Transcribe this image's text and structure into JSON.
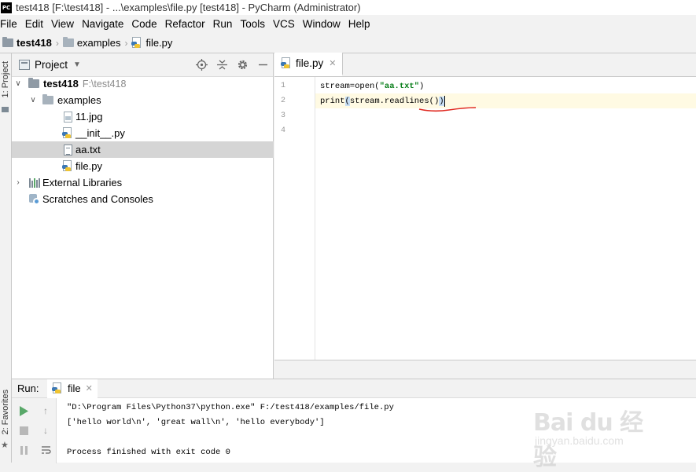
{
  "window": {
    "title": "test418 [F:\\test418] - ...\\examples\\file.py [test418] - PyCharm (Administrator)"
  },
  "menu": [
    "File",
    "Edit",
    "View",
    "Navigate",
    "Code",
    "Refactor",
    "Run",
    "Tools",
    "VCS",
    "Window",
    "Help"
  ],
  "breadcrumb": {
    "project": "test418",
    "folder": "examples",
    "file": "file.py"
  },
  "tool_stripe": {
    "project_label": "1: Project",
    "favorites_label": "2: Favorites"
  },
  "project_panel": {
    "title": "Project",
    "tree": [
      {
        "label": "test418",
        "extra": "F:\\test418",
        "icon": "folder-icon"
      },
      {
        "label": "examples",
        "icon": "folder-icon"
      },
      {
        "label": "11.jpg",
        "icon": "image-file-icon"
      },
      {
        "label": "__init__.py",
        "icon": "python-file-icon"
      },
      {
        "label": "aa.txt",
        "icon": "text-file-icon",
        "selected": true
      },
      {
        "label": "file.py",
        "icon": "python-file-icon"
      },
      {
        "label": "External Libraries",
        "icon": "library-icon"
      },
      {
        "label": "Scratches and Consoles",
        "icon": "scratches-icon"
      }
    ]
  },
  "editor": {
    "tab_label": "file.py",
    "line_numbers": [
      "1",
      "2",
      "3",
      "4"
    ],
    "code": {
      "line1_pre": "stream=open(",
      "line1_str": "\"aa.txt\"",
      "line1_post": ")",
      "line2_pre": "print",
      "line2_paren_open": "(",
      "line2_mid": "stream.readlines()",
      "line2_paren_close": ")"
    }
  },
  "run_panel": {
    "label": "Run:",
    "tab_label": "file",
    "console": [
      "\"D:\\Program Files\\Python37\\python.exe\" F:/test418/examples/file.py",
      "['hello world\\n', 'great wall\\n', 'hello everybody']",
      "",
      "Process finished with exit code 0"
    ]
  },
  "watermark": {
    "logo": "Bai du 经验",
    "url": "jingyan.baidu.com"
  },
  "colors": {
    "accent_run_green": "#59a869",
    "string_green": "#067d17",
    "annotation_red": "#e0281f",
    "selection_gray": "#d5d5d5"
  }
}
